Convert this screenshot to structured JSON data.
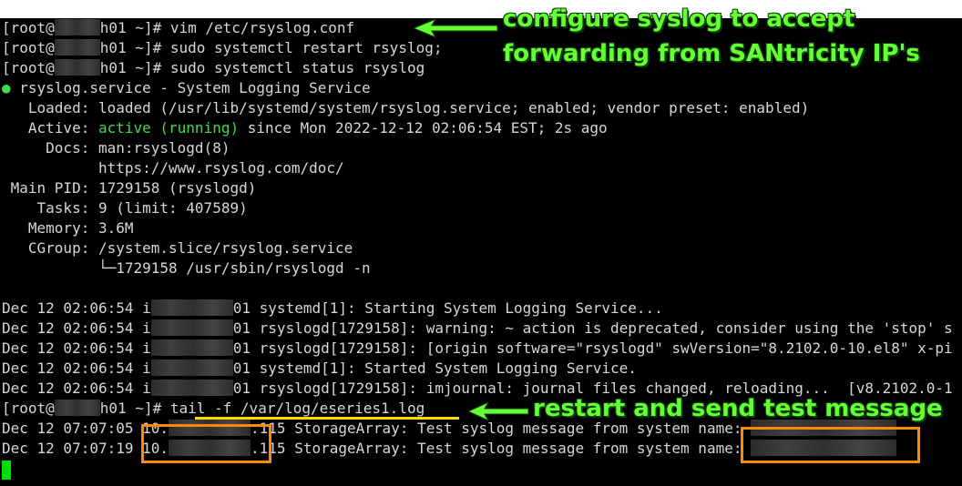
{
  "terminal": {
    "lines": {
      "l1": {
        "prompt_a": "[root@",
        "prompt_b": "h01 ~]# ",
        "cmd": "vim /etc/rsyslog.conf"
      },
      "l2": {
        "prompt_a": "[root@",
        "prompt_b": "h01 ~]# ",
        "cmd": "sudo systemctl restart rsyslog;"
      },
      "l3": {
        "prompt_a": "[root@",
        "prompt_b": "h01 ~]# ",
        "cmd": "sudo systemctl status rsyslog"
      },
      "l4": {
        "dot": "●",
        "text": " rsyslog.service - System Logging Service"
      },
      "l5": {
        "text": "   Loaded: loaded (/usr/lib/systemd/system/rsyslog.service; enabled; vendor preset: enabled)"
      },
      "l6": {
        "pre": "   Active: ",
        "status": "active (running)",
        "post": " since Mon 2022-12-12 02:06:54 EST; 2s ago"
      },
      "l7": {
        "text": "     Docs: man:rsyslogd(8)"
      },
      "l8": {
        "text": "           https://www.rsyslog.com/doc/"
      },
      "l9": {
        "text": " Main PID: 1729158 (rsyslogd)"
      },
      "l10": {
        "text": "    Tasks: 9 (limit: 407589)"
      },
      "l11": {
        "text": "   Memory: 3.6M"
      },
      "l12": {
        "text": "   CGroup: /system.slice/rsyslog.service"
      },
      "l13": {
        "text": "           └─1729158 /usr/sbin/rsyslogd -n"
      },
      "l14": {
        "pre": "Dec 12 02:06:54 i",
        "post": "01 systemd[1]: Starting System Logging Service..."
      },
      "l15": {
        "pre": "Dec 12 02:06:54 i",
        "post": "01 rsyslogd[1729158]: warning: ~ action is deprecated, consider using the 'stop' s"
      },
      "l16": {
        "pre": "Dec 12 02:06:54 i",
        "post": "01 rsyslogd[1729158]: [origin software=\"rsyslogd\" swVersion=\"8.2102.0-10.el8\" x-pi"
      },
      "l17": {
        "pre": "Dec 12 02:06:54 i",
        "post": "01 systemd[1]: Started System Logging Service."
      },
      "l18": {
        "pre": "Dec 12 02:06:54 i",
        "post": "01 rsyslogd[1729158]: imjournal: journal files changed, reloading...  [v8.2102.0-1"
      },
      "l19": {
        "prompt_a": "[root@",
        "prompt_b": "h01 ~]# ",
        "cmd": "tail -f /var/log/eseries1.log"
      },
      "l20": {
        "time": "Dec 12 07:07:05 ",
        "ip_a": "10.",
        "ip_b": ".115",
        "msg": " StorageArray: Test syslog message from system name: "
      },
      "l21": {
        "time": "Dec 12 07:07:19 ",
        "ip_a": "10.",
        "ip_b": ".115",
        "msg": " StorageArray: Test syslog message from system name: "
      }
    }
  },
  "annotations": {
    "note1_line1": "configure syslog to accept",
    "note1_line2": "forwarding from SANtricity IP's",
    "note2": "restart and send test message"
  },
  "colors": {
    "annotation_text": "#66ff33",
    "highlight_box": "#ff8a00",
    "underline": "#ffd800",
    "active_status": "#44d94a",
    "terminal_bg": "#000000"
  }
}
